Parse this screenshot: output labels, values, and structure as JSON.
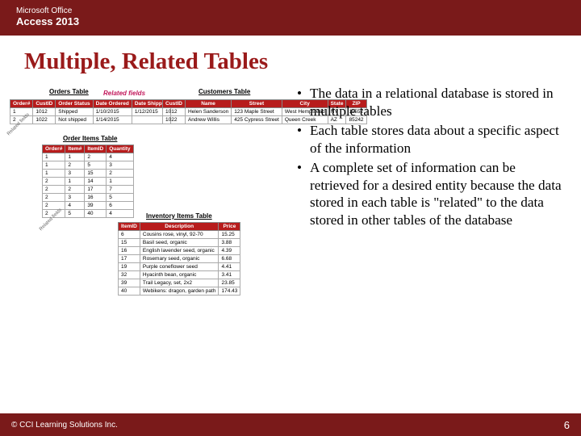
{
  "header": {
    "line1": "Microsoft Office",
    "line2": "Access 2013"
  },
  "title": "Multiple, Related Tables",
  "bullets": [
    "The data in a relational database is stored in multiple tables",
    "Each table stores data about a specific aspect of the information",
    "A complete set of information can be retrieved for a desired entity because the data stored in each table is \"related\" to the data stored in other tables of the database"
  ],
  "labels": {
    "orders": "Orders Table",
    "related": "Related fields",
    "customers": "Customers Table",
    "orderItems": "Order Items Table",
    "inventory": "Inventory Items Table",
    "related2": "Related fields"
  },
  "ordersTable": {
    "headers": [
      "Order#",
      "CustID",
      "Order Status",
      "Date Ordered",
      "Date Shipped"
    ],
    "rows": [
      [
        "1",
        "1012",
        "Shipped",
        "1/10/2015",
        "1/12/2015"
      ],
      [
        "2",
        "1022",
        "Not shipped",
        "1/14/2015",
        ""
      ]
    ]
  },
  "customersTable": {
    "headers": [
      "CustID",
      "Name",
      "Street",
      "City",
      "State",
      "ZIP"
    ],
    "rows": [
      [
        "1012",
        "Helen Sanderson",
        "123 Maple Street",
        "West Hempstead",
        "NY",
        "11552"
      ],
      [
        "1022",
        "Andrew Willis",
        "425 Cypress Street",
        "Queen Creek",
        "AZ",
        "85242"
      ]
    ]
  },
  "orderItemsTable": {
    "headers": [
      "Order#",
      "Item#",
      "ItemID",
      "Quantity"
    ],
    "rows": [
      [
        "1",
        "1",
        "2",
        "4"
      ],
      [
        "1",
        "2",
        "5",
        "3"
      ],
      [
        "1",
        "3",
        "15",
        "2"
      ],
      [
        "2",
        "1",
        "14",
        "1"
      ],
      [
        "2",
        "2",
        "17",
        "7"
      ],
      [
        "2",
        "3",
        "16",
        "5"
      ],
      [
        "2",
        "4",
        "39",
        "6"
      ],
      [
        "2",
        "5",
        "40",
        "4"
      ]
    ]
  },
  "inventoryTable": {
    "headers": [
      "ItemID",
      "Description",
      "Price"
    ],
    "rows": [
      [
        "6",
        "Cousins rose, vinyl, 92-70",
        "15.25"
      ],
      [
        "15",
        "Basil seed, organic",
        "3.88"
      ],
      [
        "16",
        "English lavender seed, organic",
        "4.39"
      ],
      [
        "17",
        "Rosemary seed, organic",
        "6.68"
      ],
      [
        "19",
        "Purple coneflower seed",
        "4.41"
      ],
      [
        "32",
        "Hyacinth bean, organic",
        "3.41"
      ],
      [
        "39",
        "Trail Legacy, set, 2x2",
        "23.85"
      ],
      [
        "40",
        "Webikens: dragon, garden path",
        "174.43"
      ]
    ]
  },
  "footer": {
    "copyright": "© CCI Learning Solutions Inc.",
    "page": "6"
  }
}
